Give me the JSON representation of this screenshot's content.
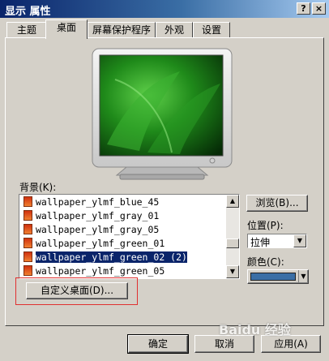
{
  "window": {
    "title": "显示 属性",
    "help_label": "?",
    "close_label": "×"
  },
  "tabs": [
    {
      "label": "主题"
    },
    {
      "label": "桌面"
    },
    {
      "label": "屏幕保护程序"
    },
    {
      "label": "外观"
    },
    {
      "label": "设置"
    }
  ],
  "background": {
    "label": "背景(K):",
    "items": [
      {
        "label": "wallpaper_ylmf_blue_45"
      },
      {
        "label": "wallpaper_ylmf_gray_01"
      },
      {
        "label": "wallpaper_ylmf_gray_05"
      },
      {
        "label": "wallpaper_ylmf_green_01"
      },
      {
        "label": "wallpaper_ylmf_green_02 (2)"
      },
      {
        "label": "wallpaper_ylmf_green_05"
      }
    ]
  },
  "browse_label": "浏览(B)...",
  "position": {
    "label": "位置(P):",
    "value": "拉伸"
  },
  "color": {
    "label": "颜色(C):",
    "swatch": "#3a6ea5"
  },
  "customize_label": "自定义桌面(D)...",
  "footer": {
    "ok_label": "确定",
    "cancel_label": "取消",
    "apply_label": "应用(A)"
  },
  "watermark": "Baidu 经验",
  "colors": {
    "title_start": "#0a246a",
    "face": "#d4d0c8",
    "highlight_box": "#e03030"
  }
}
